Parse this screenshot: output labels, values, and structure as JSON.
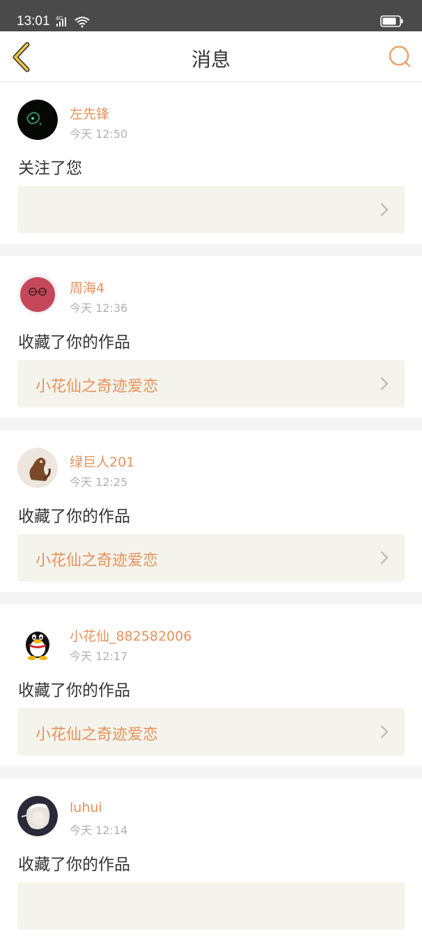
{
  "status_bar": {
    "time": "13:01",
    "network": "4G"
  },
  "header": {
    "title": "消息"
  },
  "messages": [
    {
      "name": "左先锋",
      "time": "今天 12:50",
      "action": "关注了您",
      "work": ""
    },
    {
      "name": "周海4",
      "time": "今天 12:36",
      "action": "收藏了你的作品",
      "work": "小花仙之奇迹爱恋"
    },
    {
      "name": "绿巨人201",
      "time": "今天 12:25",
      "action": "收藏了你的作品",
      "work": "小花仙之奇迹爱恋"
    },
    {
      "name": "小花仙_882582006",
      "time": "今天 12:17",
      "action": "收藏了你的作品",
      "work": "小花仙之奇迹爱恋"
    },
    {
      "name": "luhui",
      "time": "今天 12:14",
      "action": "收藏了你的作品",
      "work": ""
    }
  ],
  "colors": {
    "accent": "#e8905a",
    "status_bar": "#4a4a4a",
    "box_bg": "#f4f4ed",
    "separator": "#f5f5f5"
  },
  "icons": {
    "back": "chevron-left-icon",
    "search": "search-icon",
    "chevron": "chevron-right-icon"
  }
}
